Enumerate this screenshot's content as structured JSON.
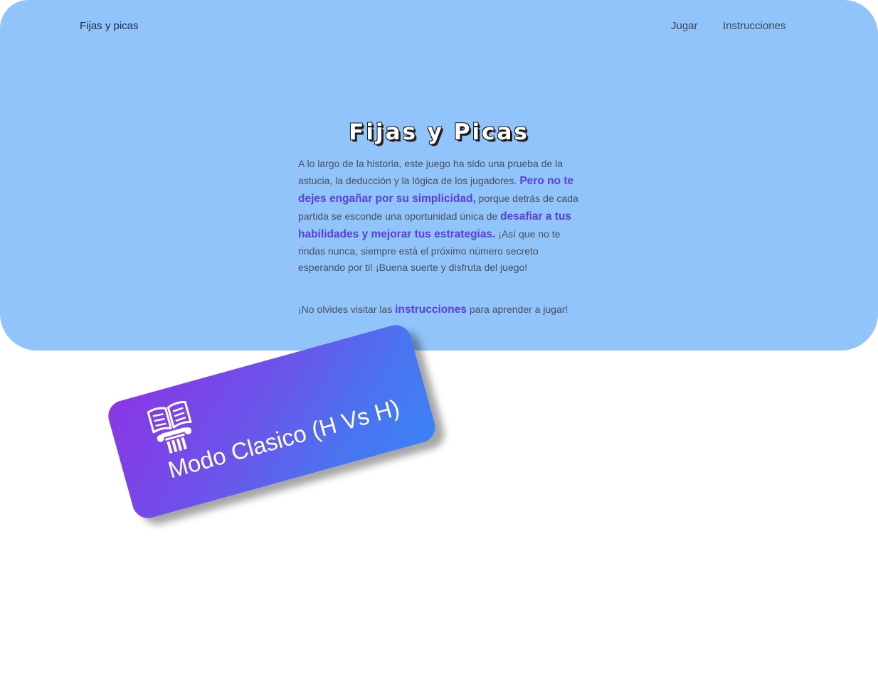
{
  "nav": {
    "brand": "Fijas y picas",
    "links": [
      "Jugar",
      "Instrucciones"
    ]
  },
  "hero": {
    "title": "Fijas y Picas",
    "intro": {
      "part1": "A lo largo de la historia, este juego ha sido una prueba de la astucia, la deducción y la lógica de los jugadores. ",
      "highlight1": "Pero no te dejes engañar por su simplicidad,",
      "part2": " porque detrás de cada partida se esconde una oportunidad única de ",
      "highlight2": "desafiar a tus habilidades y mejorar tus estrategias.",
      "part3": " ¡Así que no te rindas nunca, siempre está el próximo número secreto esperando por ti! ¡Buena suerte y disfruta del juego!"
    },
    "reminder": {
      "before": "¡No olvides visitar las ",
      "link": "instrucciones",
      "after": " para aprender a jugar!"
    }
  },
  "modes": [
    {
      "label": "Modo Clasico (H Vs H)",
      "icon": "book-column-icon"
    }
  ],
  "colors": {
    "hero_bg": "#90c4fb",
    "accent": "#5a3ee0",
    "card_gradient_start": "#8b35e6",
    "card_gradient_end": "#3b82f6"
  }
}
